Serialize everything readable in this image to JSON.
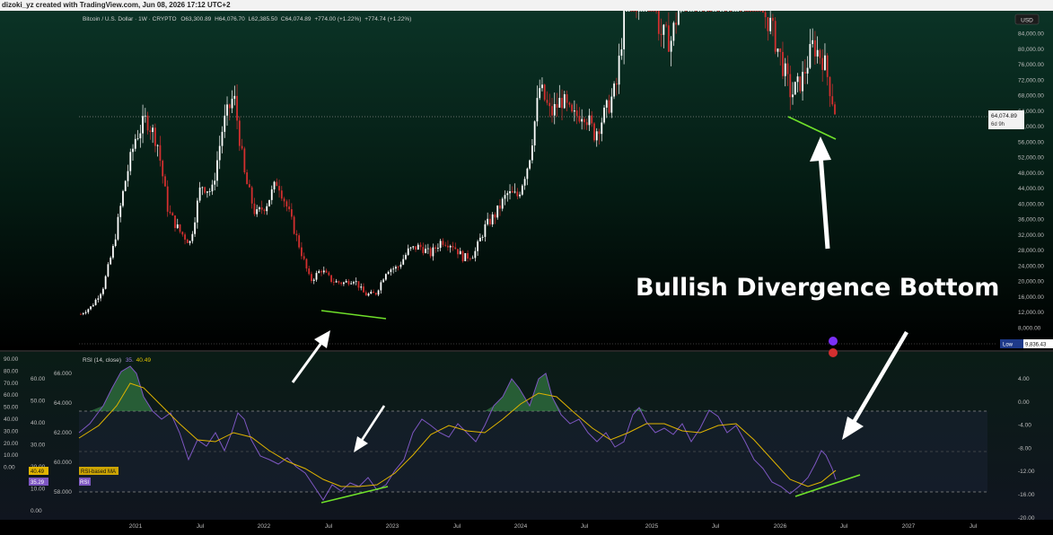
{
  "watermark": "dizoki_yz created with TradingView.com, Jun 08, 2026 17:12 UTC+2",
  "legend": {
    "symbol": "Bitcoin / U.S. Dollar · 1W · CRYPTO",
    "open": "O63,300.89",
    "high": "H64,076.70",
    "low": "L62,385.50",
    "close": "C64,074.89",
    "change": "+774.00 (+1.22%)",
    "change_repeat": "+774.74 (+1.22%)"
  },
  "currency_badge": "USD",
  "price_axis": [
    "84,000.00",
    "80,000.00",
    "76,000.00",
    "72,000.00",
    "68,000.00",
    "64,000.00",
    "60,000.00",
    "56,000.00",
    "52,000.00",
    "48,000.00",
    "44,000.00",
    "40,000.00",
    "36,000.00",
    "32,000.00",
    "28,000.00",
    "24,000.00",
    "20,000.00",
    "16,000.00",
    "12,000.00",
    "8,000.00"
  ],
  "last_price": {
    "value": "64,074.89",
    "countdown": "6d 9h"
  },
  "low_tag": {
    "label": "Low",
    "value": "9,836.43"
  },
  "annotation": "Bullish Divergence Bottom",
  "rsi_panel": {
    "title": "RSI (14, close)",
    "value_a": "35.",
    "value_b": "40.49",
    "ma_value": "40.49",
    "rsi_value": "35.29",
    "ma_label": "RSI-based MA",
    "rsi_label": "RSI",
    "left_axis_a": [
      "90.00",
      "80.00",
      "70.00",
      "60.00",
      "50.00",
      "40.00",
      "30.00",
      "20.00",
      "10.00",
      "0.00"
    ],
    "left_axis_b": [
      "66.000",
      "64.000",
      "62.000",
      "60.000",
      "58.000"
    ],
    "right_axis": [
      "4.00",
      "0.00",
      "-4.00",
      "-8.00",
      "-12.00",
      "-16.00",
      "-20.00"
    ],
    "left_axis_c": [
      "60.00",
      "50.00",
      "40.00",
      "30.00",
      "20.00",
      "10.00",
      "0.00"
    ]
  },
  "time_axis": [
    "2021",
    "Jul",
    "2022",
    "Jul",
    "2023",
    "Jul",
    "2024",
    "Jul",
    "2025",
    "Jul",
    "2026",
    "Jul",
    "2027",
    "Jul"
  ],
  "colors": {
    "up": "#ffffff",
    "down": "#d32f2f",
    "divergence": "#4caf1a",
    "rsi": "#7e57c2",
    "rsi_ma": "#e0b400",
    "bg_top": "#0b3326",
    "bg_bottom": "#000000"
  },
  "chart_data": {
    "type": "candlestick",
    "interval": "1W",
    "ylim": [
      8000,
      88000
    ],
    "scale": "linear",
    "points": [
      [
        "2020-10",
        11500
      ],
      [
        "2020-11",
        13500
      ],
      [
        "2020-12",
        18000
      ],
      [
        "2021-01",
        29000
      ],
      [
        "2021-02",
        45000
      ],
      [
        "2021-03",
        57000
      ],
      [
        "2021-04",
        62000
      ],
      [
        "2021-04b",
        56000
      ],
      [
        "2021-05",
        38000
      ],
      [
        "2021-06",
        33000
      ],
      [
        "2021-07",
        30000
      ],
      [
        "2021-08",
        45000
      ],
      [
        "2021-09",
        43000
      ],
      [
        "2021-10",
        60000
      ],
      [
        "2021-11",
        68000
      ],
      [
        "2021-12",
        47000
      ],
      [
        "2022-01",
        37000
      ],
      [
        "2022-02",
        40000
      ],
      [
        "2022-03",
        46000
      ],
      [
        "2022-04",
        38000
      ],
      [
        "2022-05",
        29000
      ],
      [
        "2022-06",
        20000
      ],
      [
        "2022-07",
        23000
      ],
      [
        "2022-08",
        20000
      ],
      [
        "2022-09",
        19500
      ],
      [
        "2022-10",
        20500
      ],
      [
        "2022-11",
        16500
      ],
      [
        "2022-12",
        16800
      ],
      [
        "2023-01",
        23000
      ],
      [
        "2023-02",
        23500
      ],
      [
        "2023-03",
        28000
      ],
      [
        "2023-04",
        29000
      ],
      [
        "2023-05",
        27000
      ],
      [
        "2023-06",
        30500
      ],
      [
        "2023-07",
        29500
      ],
      [
        "2023-08",
        26000
      ],
      [
        "2023-09",
        27000
      ],
      [
        "2023-10",
        34000
      ],
      [
        "2023-11",
        37500
      ],
      [
        "2023-12",
        42500
      ],
      [
        "2024-01",
        42000
      ],
      [
        "2024-02",
        51000
      ],
      [
        "2024-03",
        70000
      ],
      [
        "2024-04",
        63000
      ],
      [
        "2024-05",
        67000
      ],
      [
        "2024-06",
        62000
      ],
      [
        "2024-07",
        64000
      ],
      [
        "2024-08",
        58000
      ],
      [
        "2024-09",
        63500
      ],
      [
        "2024-10",
        70000
      ],
      [
        "2024-11",
        96000
      ],
      [
        "2024-12",
        93000
      ],
      [
        "2025-01",
        102000
      ],
      [
        "2025-02",
        84000
      ],
      [
        "2025-03",
        82000
      ],
      [
        "2025-04",
        94000
      ],
      [
        "2025-05",
        104000
      ],
      [
        "2025-06",
        107000
      ],
      [
        "2025-07",
        115000
      ],
      [
        "2025-08",
        108000
      ],
      [
        "2025-09",
        114000
      ],
      [
        "2025-10",
        110000
      ],
      [
        "2025-11",
        91000
      ],
      [
        "2025-12",
        87000
      ],
      [
        "2026-01",
        78000
      ],
      [
        "2026-02",
        68000
      ],
      [
        "2026-03",
        72000
      ],
      [
        "2026-04",
        81000
      ],
      [
        "2026-05",
        77000
      ],
      [
        "2026-06",
        64074.89
      ]
    ],
    "annotations": [
      "Bullish Divergence Bottom"
    ]
  }
}
